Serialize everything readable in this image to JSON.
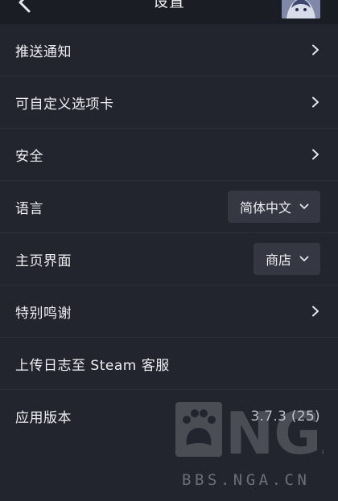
{
  "header": {
    "title": "设置",
    "back_icon": "chevron-left-icon",
    "avatar_icon": "user-avatar"
  },
  "settings": {
    "push_notifications": {
      "label": "推送通知"
    },
    "customize_tabs": {
      "label": "可自定义选项卡"
    },
    "security": {
      "label": "安全"
    },
    "language": {
      "label": "语言",
      "value": "简体中文"
    },
    "home_screen": {
      "label": "主页界面",
      "value": "商店"
    },
    "credits": {
      "label": "特别鸣谢"
    },
    "upload_logs": {
      "label": "上传日志至 Steam 客服"
    },
    "app_version": {
      "label": "应用版本",
      "value": "3.7.3 (25)"
    }
  },
  "watermark": {
    "logo_text": "NGA",
    "url": "BBS.NGA.CN"
  },
  "colors": {
    "background": "#23252e",
    "topbar": "#1b1d24",
    "divider": "#2e3039",
    "dropdown_bg": "#353843",
    "text": "#eeeff2",
    "muted_text": "#b9bcc6"
  }
}
